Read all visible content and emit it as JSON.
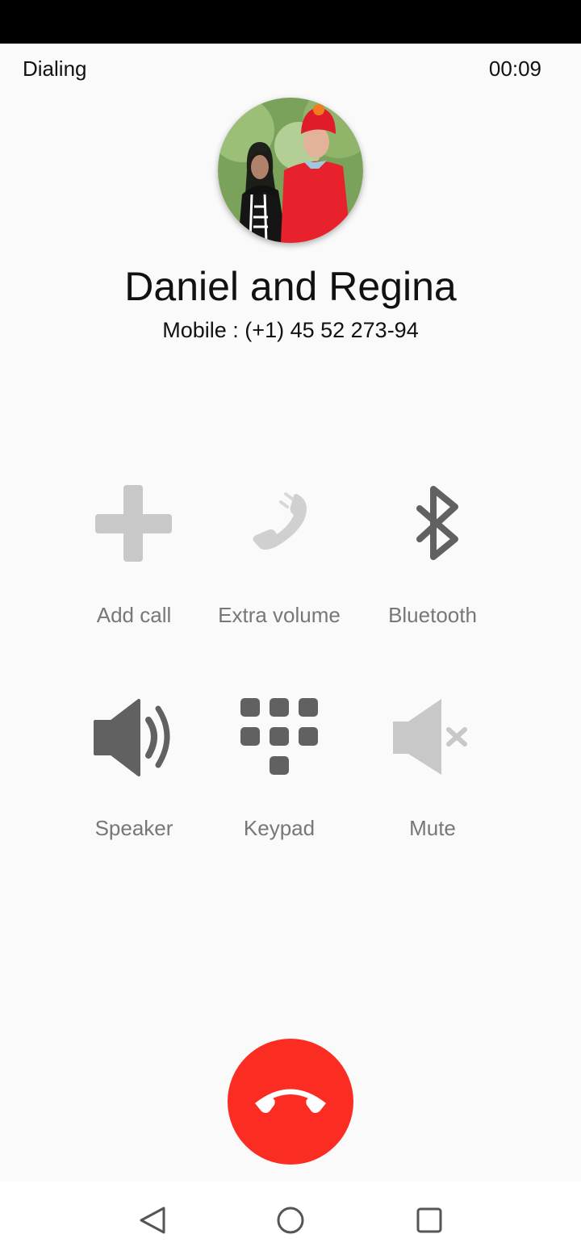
{
  "call": {
    "state": "Dialing",
    "timer": "00:09"
  },
  "contact": {
    "name": "Daniel and Regina",
    "number": "Mobile : (+1) 45 52 273-94"
  },
  "actions": [
    {
      "label": "Add call",
      "icon": "add-icon",
      "enabled": false
    },
    {
      "label": "Extra volume",
      "icon": "phone-volume-icon",
      "enabled": false
    },
    {
      "label": "Bluetooth",
      "icon": "bluetooth-icon",
      "enabled": true
    },
    {
      "label": "Speaker",
      "icon": "speaker-icon",
      "enabled": true
    },
    {
      "label": "Keypad",
      "icon": "keypad-icon",
      "enabled": true
    },
    {
      "label": "Mute",
      "icon": "mute-icon",
      "enabled": false
    }
  ],
  "colors": {
    "end_call": "#fb2c22",
    "icon_enabled": "#616161",
    "icon_disabled": "#c8c8c8",
    "label": "#777777"
  },
  "nav": {
    "back_icon": "triangle-back-icon",
    "home_icon": "circle-home-icon",
    "recents_icon": "square-recents-icon"
  }
}
